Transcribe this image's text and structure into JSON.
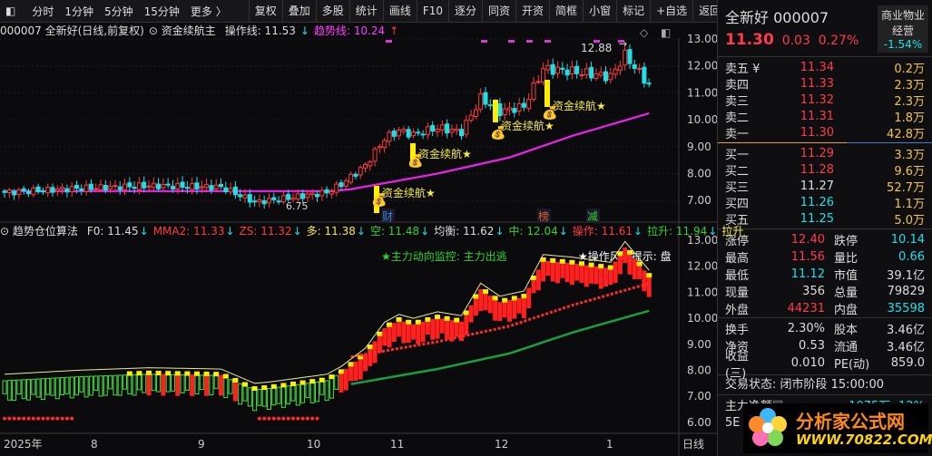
{
  "toolbar": {
    "left": [
      "分时",
      "1分钟",
      "5分钟",
      "15分钟",
      "更多 〉"
    ],
    "right": [
      "复权",
      "叠加",
      "多股",
      "统计",
      "画线",
      "F10",
      "逐分",
      "同资",
      "开资",
      "简框",
      "小窗",
      "标记",
      "+自选",
      "返回"
    ]
  },
  "main_legend": {
    "title": "000007 全新好(日线,前复权)",
    "indicator": "资金续航主",
    "op_label": "操作线: 11.53",
    "trend_label": "趋势线: 10.24"
  },
  "sub_legend": {
    "name": "趋势仓位算法",
    "items": [
      {
        "t": "F0: 11.45",
        "c": "#dddddd"
      },
      {
        "t": "MMA2: 11.33",
        "c": "#ff3b3b"
      },
      {
        "t": "ZS: 11.32",
        "c": "#ff3b3b"
      },
      {
        "t": "多: 11.38",
        "c": "#f2e94a"
      },
      {
        "t": "空: 11.48",
        "c": "#2fd22f"
      },
      {
        "t": "均衡: 11.62",
        "c": "#dddddd"
      },
      {
        "t": "中: 12.04",
        "c": "#2fd22f"
      },
      {
        "t": "操作: 11.61",
        "c": "#ff3b3b"
      },
      {
        "t": "拉升: 11.94",
        "c": "#2fd22f"
      },
      {
        "t": "拉升",
        "c": "#f2e94a"
      }
    ],
    "monitor": "★主力动向监控: 主力出逃",
    "risk": "★操作风险提示: 盘"
  },
  "annotations": {
    "signal": "资金续航★",
    "low": "6.75",
    "high": "12.88",
    "events": [
      "财",
      "榜",
      "减"
    ]
  },
  "y_axis_top": [
    "13.00",
    "12.00",
    "11.00",
    "10.00",
    "9.00",
    "8.00",
    "7.00"
  ],
  "y_axis_bottom": [
    "13.00",
    "12.00",
    "11.00",
    "10.00",
    "9.00",
    "8.00",
    "7.00",
    "6.00"
  ],
  "x_axis": {
    "labels": [
      "2025年",
      "8",
      "9",
      "10",
      "11",
      "12",
      "1"
    ],
    "period": "日线"
  },
  "chart_data": {
    "type": "candlestick",
    "price_keypoints": [
      [
        0,
        7.3
      ],
      [
        15,
        7.45
      ],
      [
        30,
        7.55
      ],
      [
        45,
        7.5
      ],
      [
        52,
        6.95
      ],
      [
        55,
        7.0
      ],
      [
        65,
        7.25
      ],
      [
        67,
        7.3
      ],
      [
        70,
        7.6
      ],
      [
        75,
        8.3
      ],
      [
        79,
        9.3
      ],
      [
        82,
        9.6
      ],
      [
        85,
        9.45
      ],
      [
        90,
        9.7
      ],
      [
        95,
        9.55
      ],
      [
        99,
        10.8
      ],
      [
        103,
        10.3
      ],
      [
        108,
        10.5
      ],
      [
        112,
        11.9
      ],
      [
        118,
        11.8
      ],
      [
        126,
        11.6
      ],
      [
        129,
        12.4
      ],
      [
        134,
        11.3
      ]
    ],
    "ma_keypoints": [
      [
        0,
        7.35
      ],
      [
        68,
        7.35
      ],
      [
        72,
        7.42
      ],
      [
        90,
        8.0
      ],
      [
        105,
        8.6
      ],
      [
        118,
        9.4
      ],
      [
        134,
        10.24
      ]
    ]
  },
  "side": {
    "name": "全新好 000007",
    "price": "11.30",
    "change": "0.03",
    "pct": "0.27%",
    "sector": "商业物业经营",
    "sector_pct": "-1.54%",
    "asks": [
      {
        "l": "卖五 ¥",
        "p": "11.34",
        "v": "0.2万"
      },
      {
        "l": "卖四",
        "p": "11.33",
        "v": "2.3万"
      },
      {
        "l": "卖三",
        "p": "11.32",
        "v": "2.3万"
      },
      {
        "l": "卖二",
        "p": "11.31",
        "v": "1.8万"
      },
      {
        "l": "卖一",
        "p": "11.30",
        "v": "42.8万"
      }
    ],
    "bids": [
      {
        "l": "买一",
        "p": "11.29",
        "v": "3.3万",
        "c": "red"
      },
      {
        "l": "买二",
        "p": "11.28",
        "v": "9.6万",
        "c": "red"
      },
      {
        "l": "买三",
        "p": "11.27",
        "v": "52.7万",
        "c": "wh"
      },
      {
        "l": "买四",
        "p": "11.26",
        "v": "1.1万",
        "c": "cy"
      },
      {
        "l": "买五",
        "p": "11.25",
        "v": "5.0万",
        "c": "cy"
      }
    ],
    "stats1": [
      {
        "a": "涨停",
        "b": "12.40",
        "bc": "red",
        "c": "跌停",
        "d": "10.14",
        "dc": "cy"
      },
      {
        "a": "最高",
        "b": "11.56",
        "bc": "red",
        "c": "量比",
        "d": "0.66",
        "dc": "cy"
      },
      {
        "a": "最低",
        "b": "11.12",
        "bc": "cy",
        "c": "市值",
        "d": "39.1亿",
        "dc": "wh"
      },
      {
        "a": "现量",
        "b": "356",
        "bc": "wh",
        "c": "总量",
        "d": "79829",
        "dc": "wh"
      },
      {
        "a": "外盘",
        "b": "44231",
        "bc": "red",
        "c": "内盘",
        "d": "35598",
        "dc": "cy"
      }
    ],
    "stats2": [
      {
        "a": "换手",
        "b": "2.30%",
        "bc": "wh",
        "c": "股本",
        "d": "3.46亿",
        "dc": "wh"
      },
      {
        "a": "净资",
        "b": "0.53",
        "bc": "wh",
        "c": "流通",
        "d": "3.46亿",
        "dc": "wh"
      },
      {
        "a": "收益(三)",
        "b": "0.010",
        "bc": "wh",
        "c": "PE(动)",
        "d": "859.0",
        "dc": "wh"
      }
    ],
    "status": "交易状态: 闭市阶段 15:00:00",
    "flow_label": "主力净额",
    "flow_value": "-1075万 -12%",
    "row5": "5E",
    "logo1": "分析家公式网",
    "logo2": "WWW.70822.COM"
  }
}
